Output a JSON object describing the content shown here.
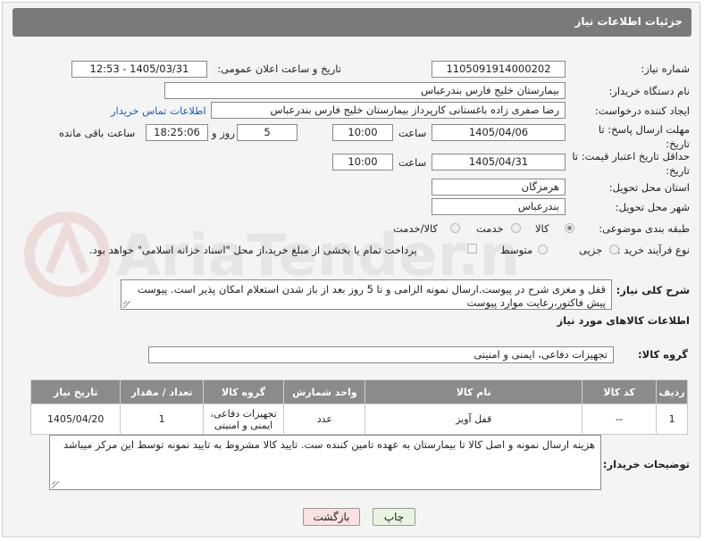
{
  "header": {
    "title": "جزئیات اطلاعات نیاز"
  },
  "form": {
    "need_number_label": "شماره نیاز:",
    "need_number": "1105091914000202",
    "announce_label": "تاریخ و ساعت اعلان عمومی:",
    "announce_value": "1405/03/31 - 12:53",
    "buyer_org_label": "نام دستگاه خریدار:",
    "buyer_org": "بیمارستان خلیج فارس بندرعباس",
    "requester_label": "ایجاد کننده درخواست:",
    "requester": "رضا صفری زاده باغستانی کارپرداز بیمارستان خلیج فارس بندرعباس",
    "buyer_contact_link": "اطلاعات تماس خریدار",
    "deadline_label": "مهلت ارسال پاسخ: تا تاریخ:",
    "deadline_date": "1405/04/06",
    "time_label": "ساعت",
    "deadline_time": "10:00",
    "days_value": "5",
    "days_label": "روز و",
    "remaining_time": "18:25:06",
    "remaining_label": "ساعت باقی مانده",
    "validity_label": "حداقل تاریخ اعتبار قیمت: تا تاریخ:",
    "validity_date": "1405/04/31",
    "validity_time": "10:00",
    "province_label": "استان محل تحویل:",
    "province": "هرمزگان",
    "city_label": "شهر محل تحویل:",
    "city": "بندرعباس",
    "category_label": "طبقه بندی موضوعی:",
    "category_options": [
      "کالا",
      "خدمت",
      "کالا/خدمت"
    ],
    "process_label": "نوع فرآیند خرید :",
    "process_options": [
      "جزیی",
      "متوسط"
    ],
    "payment_note": "پرداخت تمام یا بخشی از مبلغ خرید،از محل \"اسناد خزانه اسلامی\" خواهد بود.",
    "summary_label": "شرح کلی نیاز:",
    "summary": "قفل و مغزی شرح در پیوست.ارسال نمونه الزامی و تا 5 روز بعد از باز شدن استعلام امکان پذیر است. پیوست پیش فاکتور،رعایت موارد پیوست",
    "goods_info_title": "اطلاعات کالاهای مورد نیاز",
    "goods_group_label": "گروه کالا:",
    "goods_group": "تجهیزات دفاعی، ایمنی و امنیتی"
  },
  "table": {
    "columns": [
      "ردیف",
      "کد کالا",
      "نام کالا",
      "واحد شمارش",
      "گروه کالا",
      "تعداد / مقدار",
      "تاریخ نیاز"
    ],
    "rows": [
      [
        "1",
        "--",
        "قفل آویز",
        "عدد",
        "تجهیزات دفاعی، ایمنی و امنیتی",
        "1",
        "1405/04/20"
      ]
    ]
  },
  "buyer_notes_label": "توضیحات خریدار:",
  "buyer_notes": "هزینه ارسال نمونه و اصل کالا تا بیمارستان به عهده تامین کننده ست. تایید کالا مشروط به تایید نمونه توسط این مرکز میباشد",
  "buttons": {
    "print": "چاپ",
    "back": "بازگشت"
  },
  "watermark_text": "AriaTender.net",
  "colors": {
    "header_bg": "#7a7a7a",
    "link": "#1a5fb4",
    "print_btn": "#e8f4e0",
    "back_btn": "#fbe1e1"
  }
}
